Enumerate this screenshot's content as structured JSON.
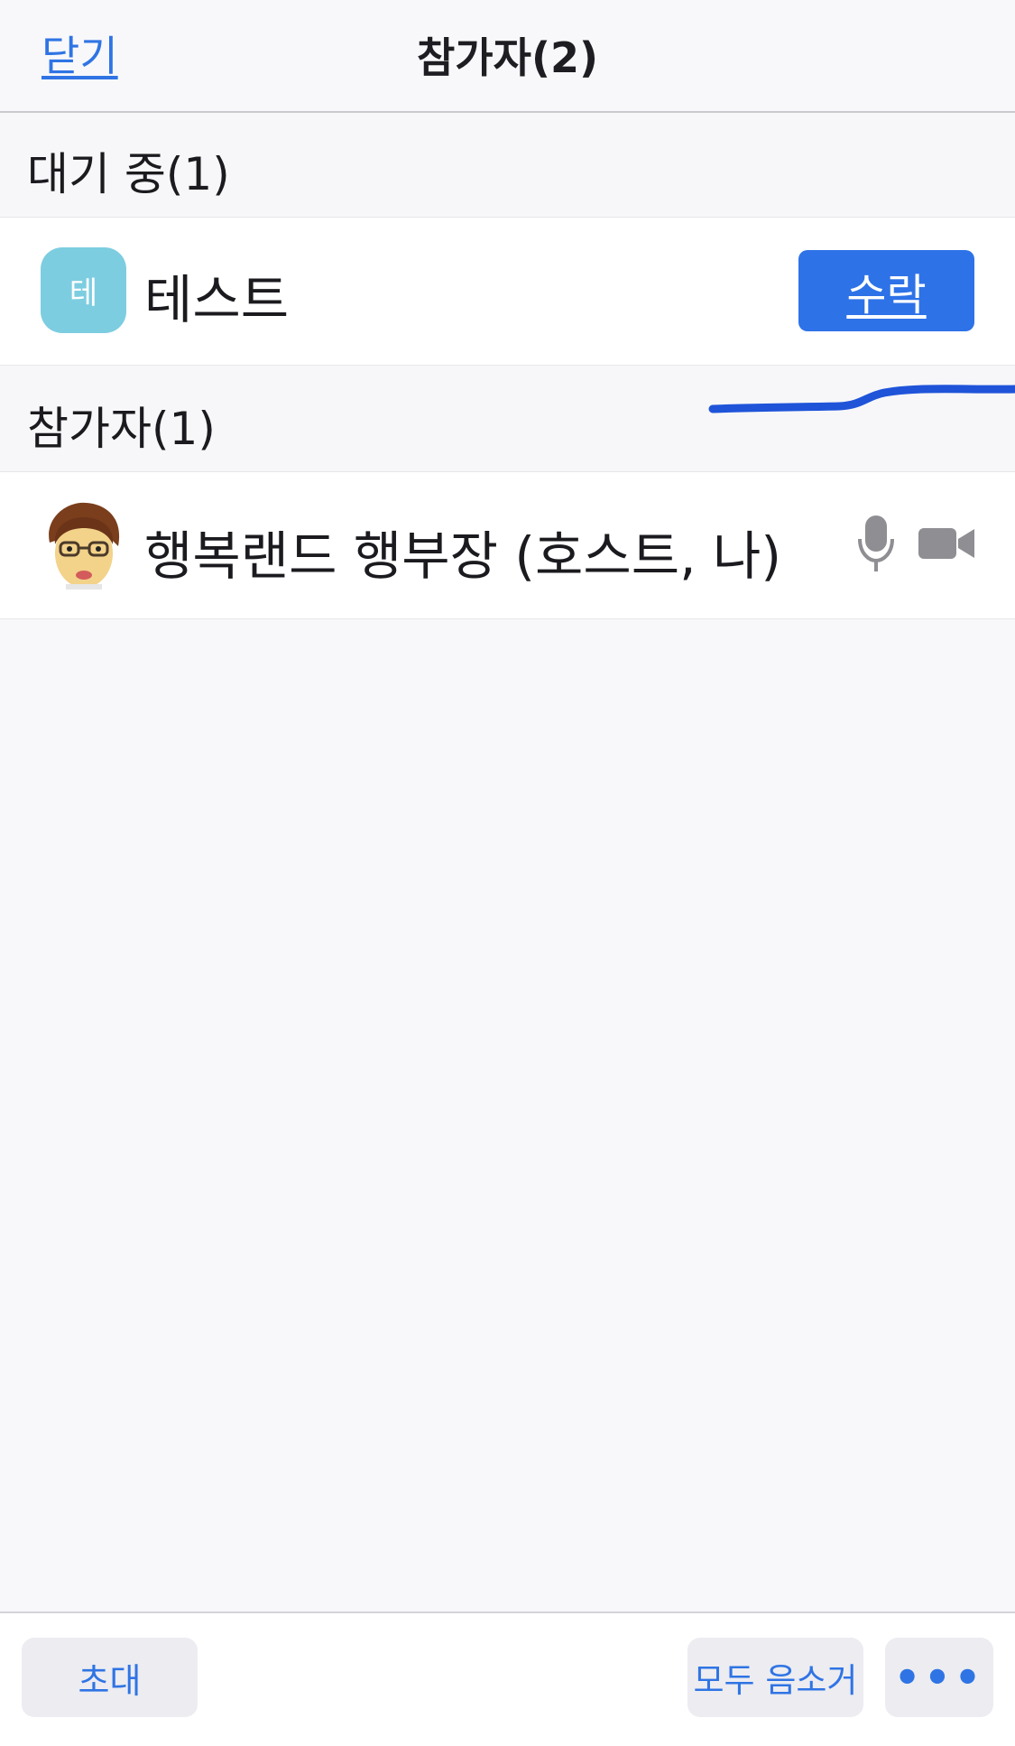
{
  "header": {
    "close_label": "닫기",
    "title": "참가자(2)"
  },
  "waiting_section": {
    "title": "대기 중(1)",
    "items": [
      {
        "avatar_letter": "테",
        "name": "테스트",
        "admit_label": "수락"
      }
    ]
  },
  "participants_section": {
    "title": "참가자(1)",
    "items": [
      {
        "name": "행복랜드 행부장 (호스트, 나)",
        "mic_icon": "microphone-icon",
        "video_icon": "video-camera-icon"
      }
    ]
  },
  "toolbar": {
    "invite_label": "초대",
    "mute_all_label": "모두 음소거",
    "more_label": "•••"
  },
  "colors": {
    "accent": "#2e72e8",
    "link": "#2f74e4",
    "avatar_bg": "#7dcde0",
    "annotation": "#1f54d9"
  }
}
